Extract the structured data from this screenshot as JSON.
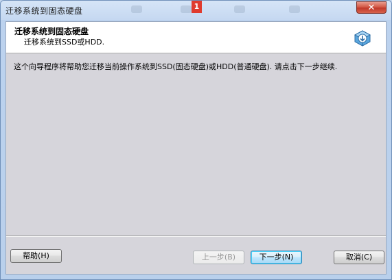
{
  "window": {
    "title": "迁移系统到固态硬盘",
    "badge": "1",
    "close_label": "✕"
  },
  "header": {
    "title": "迁移系统到固态硬盘",
    "subtitle": "迁移系统到SSD或HDD.",
    "icon": "disk-migrate-icon"
  },
  "body": {
    "description": "这个向导程序将帮助您迁移当前操作系统到SSD(固态硬盘)或HDD(普通硬盘). 请点击下一步继续."
  },
  "buttons": {
    "help": "帮助(H)",
    "back": "上一步(B)",
    "next": "下一步(N)",
    "cancel": "取消(C)"
  }
}
